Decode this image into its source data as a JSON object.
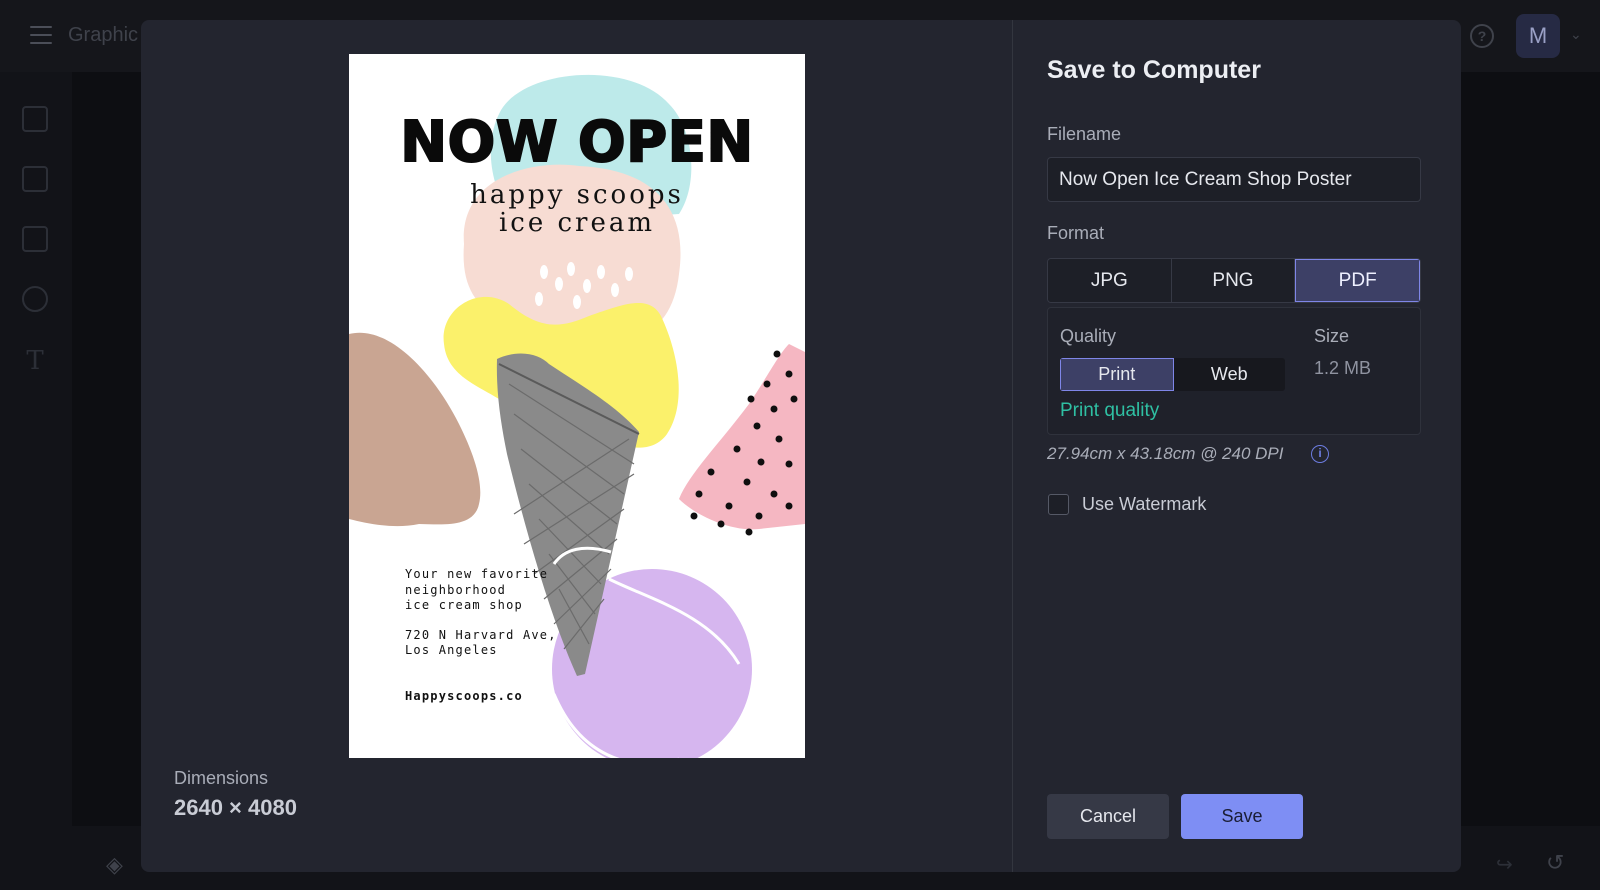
{
  "app": {
    "title": "Graphic",
    "avatar_initial": "M",
    "help_icon": "help-circle-icon"
  },
  "modal": {
    "title": "Save to Computer",
    "filename_label": "Filename",
    "filename_value": "Now Open Ice Cream Shop Poster",
    "format_label": "Format",
    "formats": [
      "JPG",
      "PNG",
      "PDF"
    ],
    "selected_format": "PDF",
    "quality_label": "Quality",
    "quality_options": [
      "Print",
      "Web"
    ],
    "selected_quality": "Print",
    "quality_hint": "Print quality",
    "size_label": "Size",
    "size_value": "1.2 MB",
    "dpi_text": "27.94cm x 43.18cm @ 240 DPI",
    "watermark_label": "Use Watermark",
    "watermark_checked": false,
    "cancel_label": "Cancel",
    "save_label": "Save"
  },
  "preview": {
    "dimensions_label": "Dimensions",
    "dimensions_value": "2640 × 4080",
    "poster": {
      "headline": "NOW OPEN",
      "subtitle_line1": "happy scoops",
      "subtitle_line2": "ice cream",
      "body_line1": "Your new favorite",
      "body_line2": "neighborhood",
      "body_line3": "ice cream shop",
      "address_line1": "720 N Harvard Ave,",
      "address_line2": "Los Angeles",
      "website": "Happyscoops.co"
    }
  },
  "colors": {
    "accent": "#7e8ef4",
    "selected_bg": "#3d4066",
    "hint_green": "#2fc0a3",
    "modal_bg": "#23252f"
  }
}
